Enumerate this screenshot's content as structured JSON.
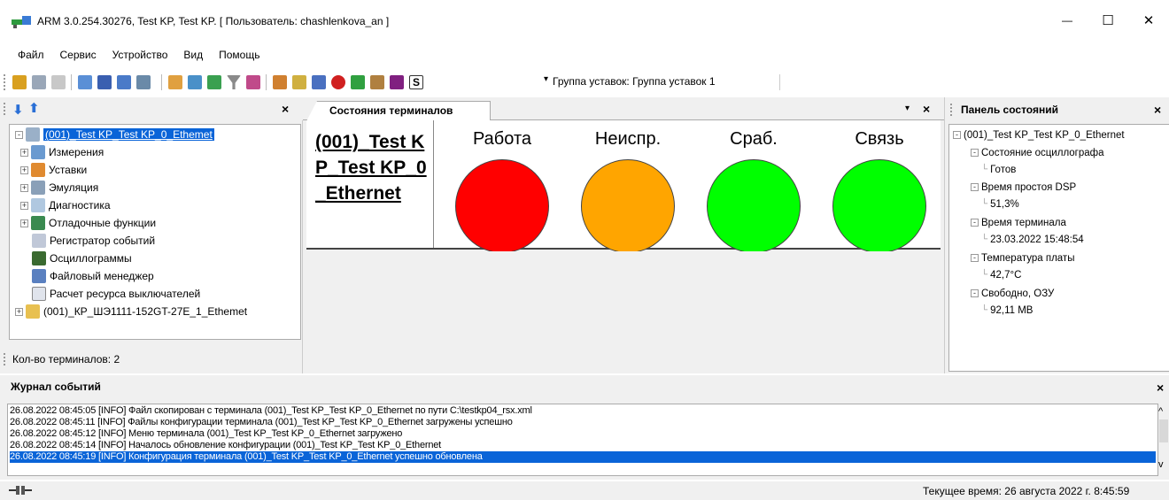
{
  "window": {
    "title": "ARM 3.0.254.30276, Test KP, Test KP. [ Пользователь: chashlenkova_an ]",
    "minimize": "—",
    "maximize": "☐",
    "close": "✕"
  },
  "menu": [
    "Файл",
    "Сервис",
    "Устройство",
    "Вид",
    "Помощь"
  ],
  "toolbar": {
    "group_label": "Группа уставок: Группа уставок 1",
    "dropdown_arrow": "▾"
  },
  "left_panel": {
    "close": "×",
    "arrow_down": "⬇",
    "arrow_up": "⬆",
    "tree": [
      {
        "label": "(001)_Test KP_Test KP_0_Ethemet",
        "level": 0,
        "expander": "⊟",
        "icon": "terminal-icon",
        "selected": true
      },
      {
        "label": "Измерения",
        "level": 1,
        "expander": "+",
        "icon": "measurements-icon"
      },
      {
        "label": "Уставки",
        "level": 1,
        "expander": "+",
        "icon": "settings-folder-icon"
      },
      {
        "label": "Эмуляция",
        "level": 1,
        "expander": "+",
        "icon": "emulation-icon"
      },
      {
        "label": "Диагностика",
        "level": 1,
        "expander": "+",
        "icon": "diagnostics-icon"
      },
      {
        "label": "Отладочные функции",
        "level": 1,
        "expander": "+",
        "icon": "debug-icon"
      },
      {
        "label": "Регистратор событий",
        "level": 1,
        "expander": "",
        "icon": "event-recorder-icon"
      },
      {
        "label": "Осциллограммы",
        "level": 1,
        "expander": "",
        "icon": "oscillogram-icon"
      },
      {
        "label": "Файловый менеджер",
        "level": 1,
        "expander": "",
        "icon": "file-manager-icon"
      },
      {
        "label": "Расчет ресурса выключателей",
        "level": 1,
        "expander": "",
        "icon": "breaker-resource-icon"
      },
      {
        "label": "(001)_КР_ШЭ1111-152GT-27E_1_Ethemet",
        "level": 0,
        "expander": "+",
        "icon": "folder-icon"
      }
    ],
    "terminals_count": "Кол-во терминалов: 2"
  },
  "center_panel": {
    "tab_label": "Состояния терминалов",
    "tab_menu": "▾",
    "tab_close": "×",
    "terminal_name": "(001)_Test KP_Test KP_0_Ethernet",
    "indicators": [
      {
        "label": "Работа",
        "color": "#ff0000"
      },
      {
        "label": "Неиспр.",
        "color": "#ffa500"
      },
      {
        "label": "Сраб.",
        "color": "#00ff00"
      },
      {
        "label": "Связь",
        "color": "#00ff00"
      }
    ]
  },
  "right_panel": {
    "title": "Панель состояний",
    "close": "×",
    "root": "(001)_Test KP_Test KP_0_Ethernet",
    "items": [
      {
        "name": "Состояние осциллографа",
        "value": "Готов"
      },
      {
        "name": "Время простоя DSP",
        "value": "51,3%"
      },
      {
        "name": "Время терминала",
        "value": "23.03.2022 15:48:54"
      },
      {
        "name": "Температура платы",
        "value": "42,7°C"
      },
      {
        "name": "Свободно, ОЗУ",
        "value": "92,11 MB"
      }
    ]
  },
  "event_log": {
    "title": "Журнал событий",
    "close": "×",
    "scroll_up": "^",
    "scroll_down": "v",
    "lines": [
      "26.08.2022 08:45:05 [INFO] Файл скопирован с терминала (001)_Test KP_Test KP_0_Ethernet по пути C:\\testkp04_rsx.xml",
      "26.08.2022 08:45:11 [INFO] Файлы конфигурации терминала (001)_Test KP_Test KP_0_Ethernet загружены успешно",
      "26.08.2022 08:45:12 [INFO] Меню терминала (001)_Test KP_Test KP_0_Ethernet загружено",
      "26.08.2022 08:45:14 [INFO] Началось обновление конфигурации (001)_Test KP_Test KP_0_Ethernet",
      "26.08.2022 08:45:19 [INFO] Конфигурация терминала (001)_Test KP_Test KP_0_Ethernet успешно обновлена"
    ],
    "selected_index": 4
  },
  "status_bar": {
    "current_time": "Текущее время: 26 августа 2022 г. 8:45:59"
  },
  "colors": {
    "selection": "#0a64d8",
    "indicator_red": "#ff0000",
    "indicator_orange": "#ffa500",
    "indicator_green": "#00ff00"
  }
}
